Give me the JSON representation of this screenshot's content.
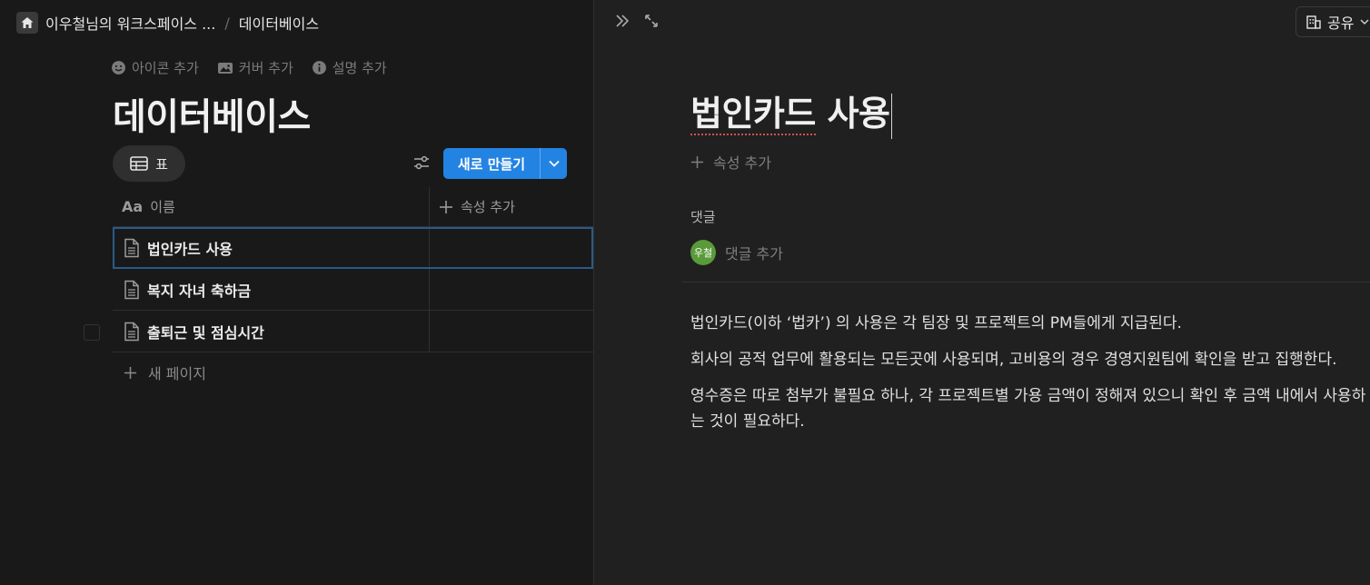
{
  "breadcrumb": {
    "workspace": "이우철님의 워크스페이스 ...",
    "separator": "/",
    "page": "데이터베이스"
  },
  "page_actions": {
    "add_icon": "아이콘 추가",
    "add_cover": "커버 추가",
    "add_description": "설명 추가"
  },
  "database": {
    "title": "데이터베이스",
    "view_tab_label": "표",
    "new_button_label": "새로 만들기",
    "columns": {
      "name_icon": "Aa",
      "name": "이름",
      "add_property": "속성 추가"
    },
    "rows": [
      {
        "title": "법인카드 사용"
      },
      {
        "title": "복지 자녀 축하금"
      },
      {
        "title": "출퇴근 및 점심시간"
      }
    ],
    "new_page_label": "새 페이지"
  },
  "peek": {
    "share_label": "공유",
    "title": "법인카드 사용",
    "title_part1": "법인카드",
    "title_part2": " 사용",
    "add_property": "속성 추가",
    "comments_label": "댓글",
    "avatar_initials": "우철",
    "comment_placeholder": "댓글 추가",
    "paragraphs": [
      "법인카드(이하 ‘법카’) 의 사용은 각 팀장 및 프로젝트의 PM들에게 지급된다.",
      "회사의 공적 업무에 활용되는 모든곳에 사용되며, 고비용의 경우 경영지원팀에 확인을 받고 집행한다.",
      "영수증은 따로 첨부가 불필요 하나, 각 프로젝트별 가용 금액이 정해져 있으니 확인 후 금액 내에서 사용하는 것이 필요하다."
    ]
  },
  "colors": {
    "accent": "#2383e2",
    "avatar_bg": "#5a9a3a",
    "background": "#191919",
    "panel": "#202020"
  },
  "icons": {
    "home": "home-icon",
    "emoji": "smiley-icon",
    "cover": "image-icon",
    "info": "info-icon",
    "table": "table-icon",
    "filter": "sliders-icon",
    "chevron": "chevron-down-icon",
    "doc": "document-icon",
    "plus": "plus-icon",
    "collapse": "double-chevron-right-icon",
    "expand": "expand-icon",
    "share": "building-icon"
  }
}
